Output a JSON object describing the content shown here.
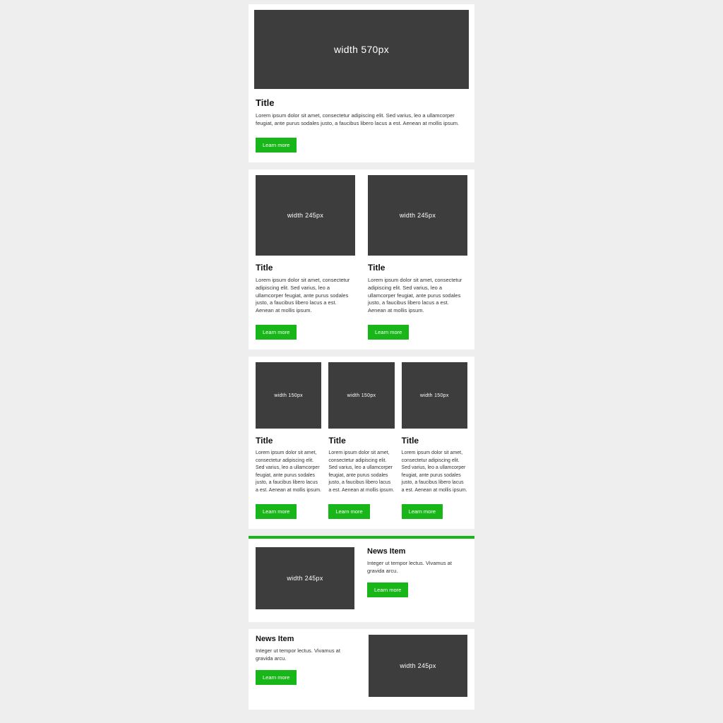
{
  "hero": {
    "image_label": "width 570px",
    "title": "Title",
    "body": "Lorem ipsum dolor sit amet, consectetur adipiscing elit. Sed varius, leo a ullamcorper feugiat, ante purus sodales justo, a faucibus libero lacus a est. Aenean at mollis ipsum.",
    "button": "Learn more"
  },
  "two_col": [
    {
      "image_label": "width 245px",
      "title": "Title",
      "body": "Lorem ipsum dolor sit amet, consectetur adipiscing elit. Sed varius, leo a ullamcorper feugiat, ante purus sodales justo, a faucibus libero lacus a est. Aenean at mollis ipsum.",
      "button": "Learn more"
    },
    {
      "image_label": "width 245px",
      "title": "Title",
      "body": "Lorem ipsum dolor sit amet, consectetur adipiscing elit. Sed varius, leo a ullamcorper feugiat, ante purus sodales justo, a faucibus libero lacus a est. Aenean at mollis ipsum.",
      "button": "Learn more"
    }
  ],
  "three_col": [
    {
      "image_label": "width 150px",
      "title": "Title",
      "body": "Lorem ipsum dolor sit amet, consectetur adipiscing elit. Sed varius, leo a ullamcorper feugiat, ante purus sodales justo, a faucibus libero lacus a est. Aenean at mollis ipsum.",
      "button": "Learn more"
    },
    {
      "image_label": "width 150px",
      "title": "Title",
      "body": "Lorem ipsum dolor sit amet, consectetur adipiscing elit. Sed varius, leo a ullamcorper feugiat, ante purus sodales justo, a faucibus libero lacus a est. Aenean at mollis ipsum.",
      "button": "Learn more"
    },
    {
      "image_label": "width 150px",
      "title": "Title",
      "body": "Lorem ipsum dolor sit amet, consectetur adipiscing elit. Sed varius, leo a ullamcorper feugiat, ante purus sodales justo, a faucibus libero lacus a est. Aenean at mollis ipsum.",
      "button": "Learn more"
    }
  ],
  "news": [
    {
      "image_label": "width 245px",
      "title": "News Item",
      "body": "Integer ut tempor lectus. Vivamus at gravida arcu.",
      "button": "Learn more"
    },
    {
      "image_label": "width 245px",
      "title": "News Item",
      "body": "Integer ut tempor lectus. Vivamus at gravida arcu.",
      "button": "Learn more"
    }
  ]
}
